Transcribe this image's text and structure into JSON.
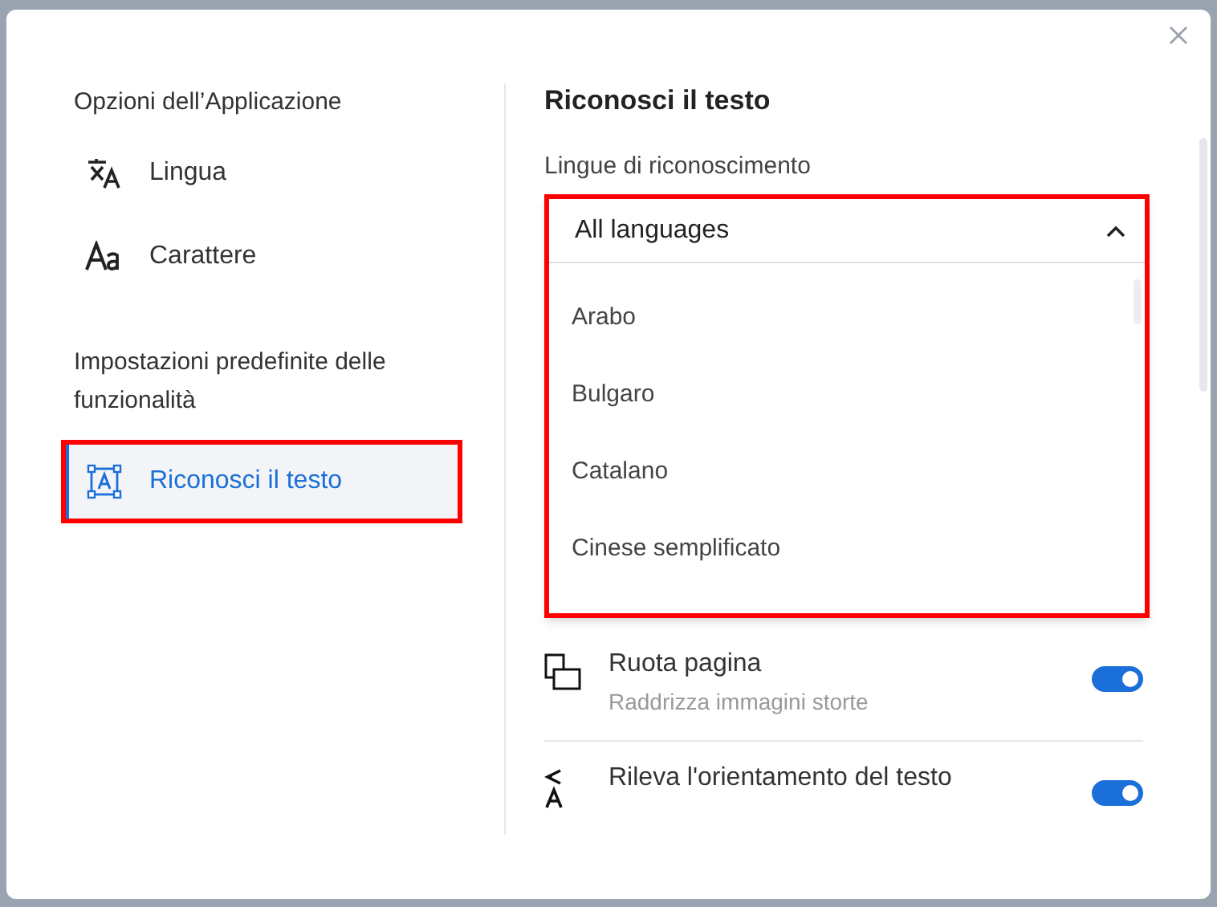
{
  "sidebar": {
    "sections": [
      {
        "title": "Opzioni dell’Applicazione",
        "items": [
          {
            "label": "Lingua",
            "selected": false,
            "annotated": false
          },
          {
            "label": "Carattere",
            "selected": false,
            "annotated": false
          }
        ]
      },
      {
        "title": "Impostazioni predefinite delle funzionalità",
        "items": [
          {
            "label": "Riconosci il testo",
            "selected": true,
            "annotated": true
          }
        ]
      }
    ]
  },
  "panel": {
    "title": "Riconosci il testo",
    "dropdown": {
      "label": "Lingue di riconoscimento",
      "value": "All languages",
      "expanded": true,
      "annotated": true,
      "options": [
        "Arabo",
        "Bulgaro",
        "Catalano",
        "Cinese semplificato"
      ]
    },
    "settings": [
      {
        "title": "Ruota pagina",
        "subtitle": "Raddrizza immagini storte",
        "on": true
      },
      {
        "title": "Rileva l'orientamento del testo",
        "on": true
      }
    ]
  }
}
